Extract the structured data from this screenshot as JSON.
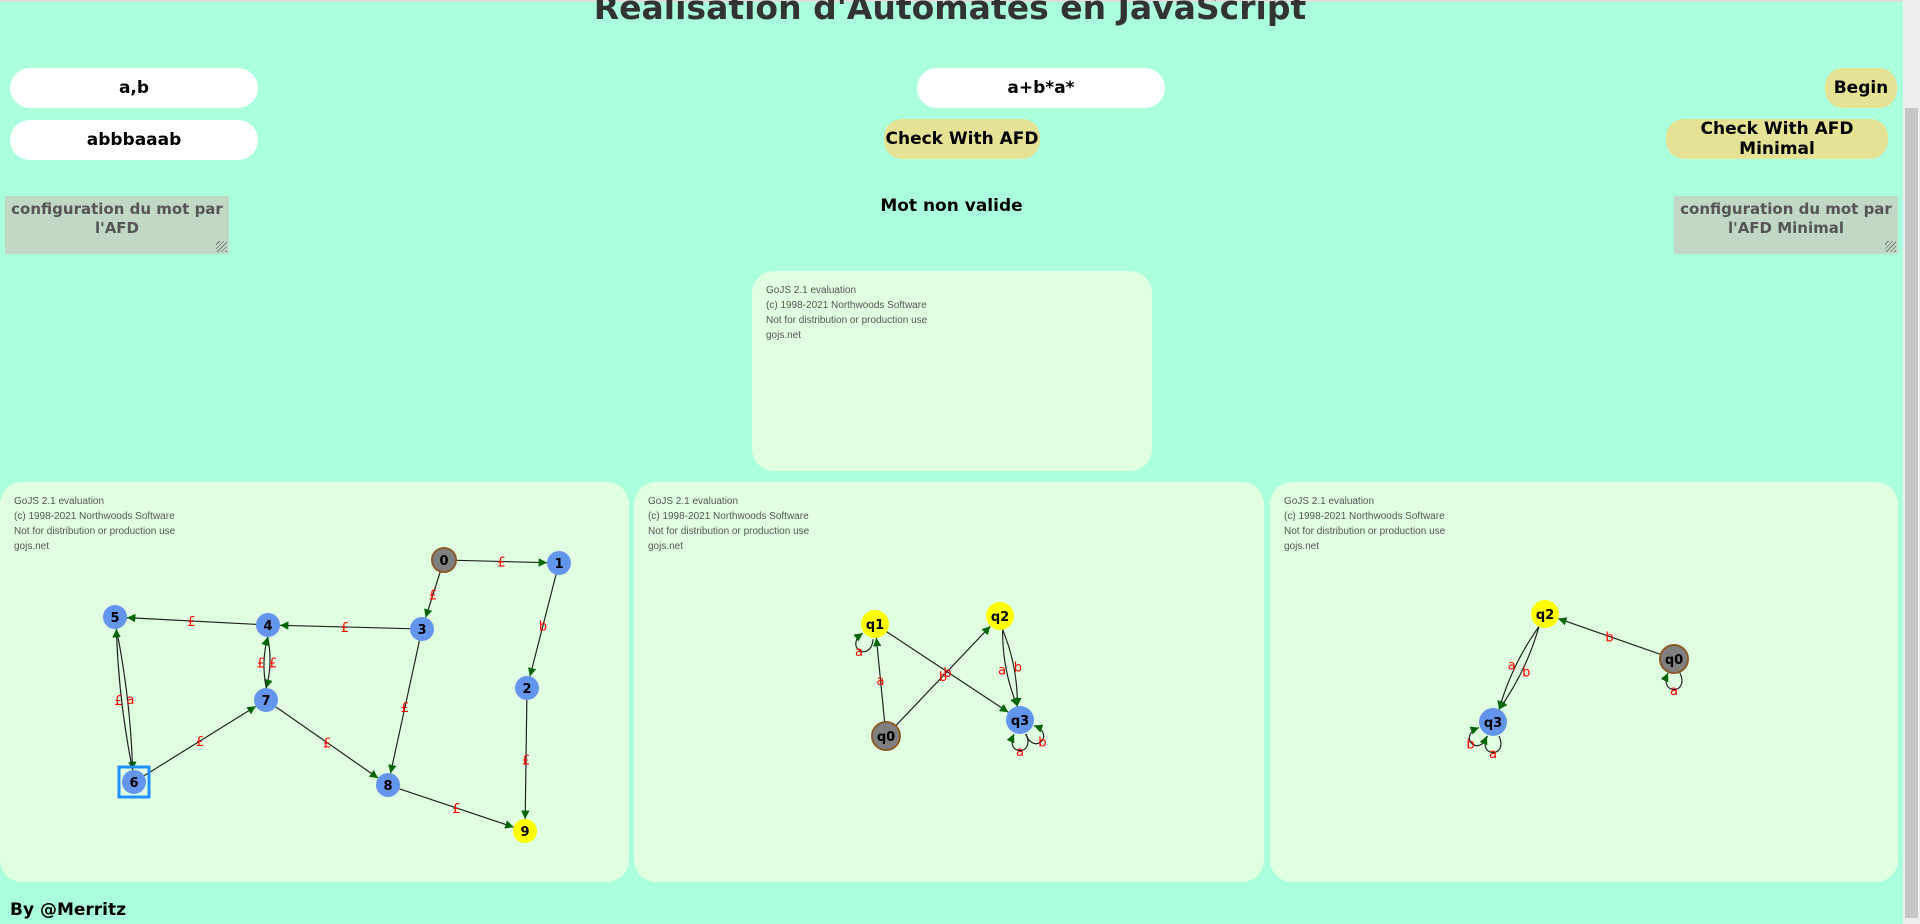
{
  "header": {
    "title": "Realisation d'Automates en JavaScript"
  },
  "inputs": {
    "alphabet": "a,b",
    "word": "abbbaaab",
    "regex": "a+b*a*"
  },
  "buttons": {
    "begin": "Begin",
    "check_afd": "Check With AFD",
    "check_afd_min": "Check With AFD Minimal"
  },
  "config": {
    "afd": "configuration du mot par l'AFD",
    "afd_min": "configuration du mot par l'AFD Minimal"
  },
  "status": "Mot non valide",
  "watermark": [
    "GoJS 2.1 evaluation",
    "(c) 1998-2021 Northwoods Software",
    "Not for distribution or production use",
    "gojs.net"
  ],
  "colors": {
    "background": "#aaffdd",
    "panel": "#e0ffe0",
    "button": "#e5e296",
    "state_normal": "#6495ed",
    "state_final": "#ffff00",
    "state_initial": "#808080",
    "edge_label": "#ff0000",
    "arrow": "#006400"
  },
  "graphs": {
    "thompson": {
      "nodes": [
        {
          "id": "0",
          "role": "initial"
        },
        {
          "id": "1",
          "role": "normal"
        },
        {
          "id": "2",
          "role": "normal"
        },
        {
          "id": "3",
          "role": "normal"
        },
        {
          "id": "4",
          "role": "normal"
        },
        {
          "id": "5",
          "role": "normal"
        },
        {
          "id": "6",
          "role": "normal",
          "selected": true
        },
        {
          "id": "7",
          "role": "normal"
        },
        {
          "id": "8",
          "role": "normal"
        },
        {
          "id": "9",
          "role": "final"
        }
      ],
      "edges": [
        {
          "from": "0",
          "to": "1",
          "label": "£"
        },
        {
          "from": "0",
          "to": "3",
          "label": "£"
        },
        {
          "from": "1",
          "to": "2",
          "label": "b"
        },
        {
          "from": "2",
          "to": "9",
          "label": "£"
        },
        {
          "from": "3",
          "to": "4",
          "label": "£"
        },
        {
          "from": "3",
          "to": "8",
          "label": "£"
        },
        {
          "from": "4",
          "to": "5",
          "label": "£"
        },
        {
          "from": "4",
          "to": "7",
          "label": "£"
        },
        {
          "from": "7",
          "to": "4",
          "label": "£"
        },
        {
          "from": "5",
          "to": "6",
          "label": "a"
        },
        {
          "from": "6",
          "to": "5",
          "label": "£"
        },
        {
          "from": "6",
          "to": "7",
          "label": "£"
        },
        {
          "from": "7",
          "to": "8",
          "label": "£"
        },
        {
          "from": "8",
          "to": "9",
          "label": "£"
        }
      ]
    },
    "afd": {
      "nodes": [
        {
          "id": "q0",
          "role": "initial"
        },
        {
          "id": "q1",
          "role": "final"
        },
        {
          "id": "q2",
          "role": "final"
        },
        {
          "id": "q3",
          "role": "normal"
        }
      ],
      "edges": [
        {
          "from": "q0",
          "to": "q1",
          "label": "a"
        },
        {
          "from": "q0",
          "to": "q2",
          "label": "b"
        },
        {
          "from": "q1",
          "to": "q1",
          "label": "a"
        },
        {
          "from": "q1",
          "to": "q3",
          "label": "b"
        },
        {
          "from": "q2",
          "to": "q3",
          "label": "b"
        },
        {
          "from": "q2",
          "to": "q3",
          "label": "a"
        },
        {
          "from": "q3",
          "to": "q3",
          "label": "b"
        },
        {
          "from": "q3",
          "to": "q3",
          "label": "a"
        }
      ]
    },
    "afd_min": {
      "nodes": [
        {
          "id": "q0",
          "role": "initial"
        },
        {
          "id": "q2",
          "role": "final"
        },
        {
          "id": "q3",
          "role": "normal"
        }
      ],
      "edges": [
        {
          "from": "q0",
          "to": "q2",
          "label": "b"
        },
        {
          "from": "q0",
          "to": "q0",
          "label": "a"
        },
        {
          "from": "q2",
          "to": "q3",
          "label": "b"
        },
        {
          "from": "q2",
          "to": "q3",
          "label": "a"
        },
        {
          "from": "q3",
          "to": "q3",
          "label": "b"
        },
        {
          "from": "q3",
          "to": "q3",
          "label": "a"
        }
      ]
    }
  },
  "footer": "By @Merritz"
}
